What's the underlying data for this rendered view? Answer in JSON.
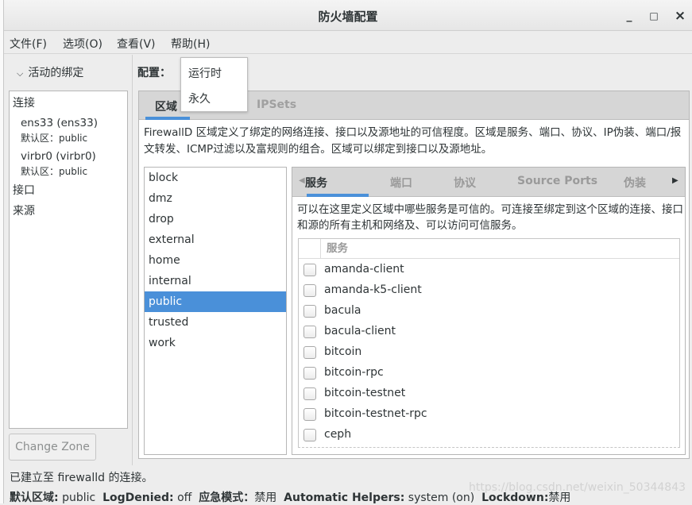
{
  "window": {
    "title": "防火墙配置",
    "minimize": "_",
    "maximize": "□",
    "close": "×"
  },
  "menu": [
    "文件(F)",
    "选项(O)",
    "查看(V)",
    "帮助(H)"
  ],
  "bindings": {
    "header": "活动的绑定",
    "connections_label": "连接",
    "connections": [
      {
        "name": "ens33 (ens33)",
        "zone": "默认区：public"
      },
      {
        "name": "virbr0 (virbr0)",
        "zone": "默认区：public"
      }
    ],
    "interfaces_label": "接口",
    "sources_label": "来源",
    "change_zone": "Change Zone"
  },
  "config": {
    "label": "配置：",
    "options": [
      "运行时",
      "永久"
    ]
  },
  "tabs": [
    {
      "label": "区域",
      "active": true
    },
    {
      "label": "IPSets",
      "active": false
    }
  ],
  "zone_description": "FirewallD 区域定义了绑定的网络连接、接口以及源地址的可信程度。区域是服务、端口、协议、IP伪装、端口/报文转发、ICMP过滤以及富规则的组合。区域可以绑定到接口以及源地址。",
  "zones": [
    "block",
    "dmz",
    "drop",
    "external",
    "home",
    "internal",
    "public",
    "trusted",
    "work"
  ],
  "selected_zone": "public",
  "inner_tabs": [
    "服务",
    "端口",
    "协议",
    "Source Ports",
    "伪装"
  ],
  "services_description": "可以在这里定义区域中哪些服务是可信的。可连接至绑定到这个区域的连接、接口和源的所有主机和网络及、可以访问可信服务。",
  "services_header": "服务",
  "services": [
    "amanda-client",
    "amanda-k5-client",
    "bacula",
    "bacula-client",
    "bitcoin",
    "bitcoin-rpc",
    "bitcoin-testnet",
    "bitcoin-testnet-rpc",
    "ceph"
  ],
  "status": {
    "message": "已建立至 firewalld 的连接。",
    "default_zone_label": "默认区域:",
    "default_zone": "public",
    "logdenied_label": "LogDenied:",
    "logdenied": "off",
    "panic_label": "应急模式：",
    "panic": "禁用",
    "helpers_label": "Automatic Helpers:",
    "helpers": "system (on)",
    "lockdown_label": "Lockdown:",
    "lockdown": "禁用"
  },
  "watermark": "https://blog.csdn.net/weixin_50344843",
  "colors": {
    "accent": "#4a90d9"
  }
}
